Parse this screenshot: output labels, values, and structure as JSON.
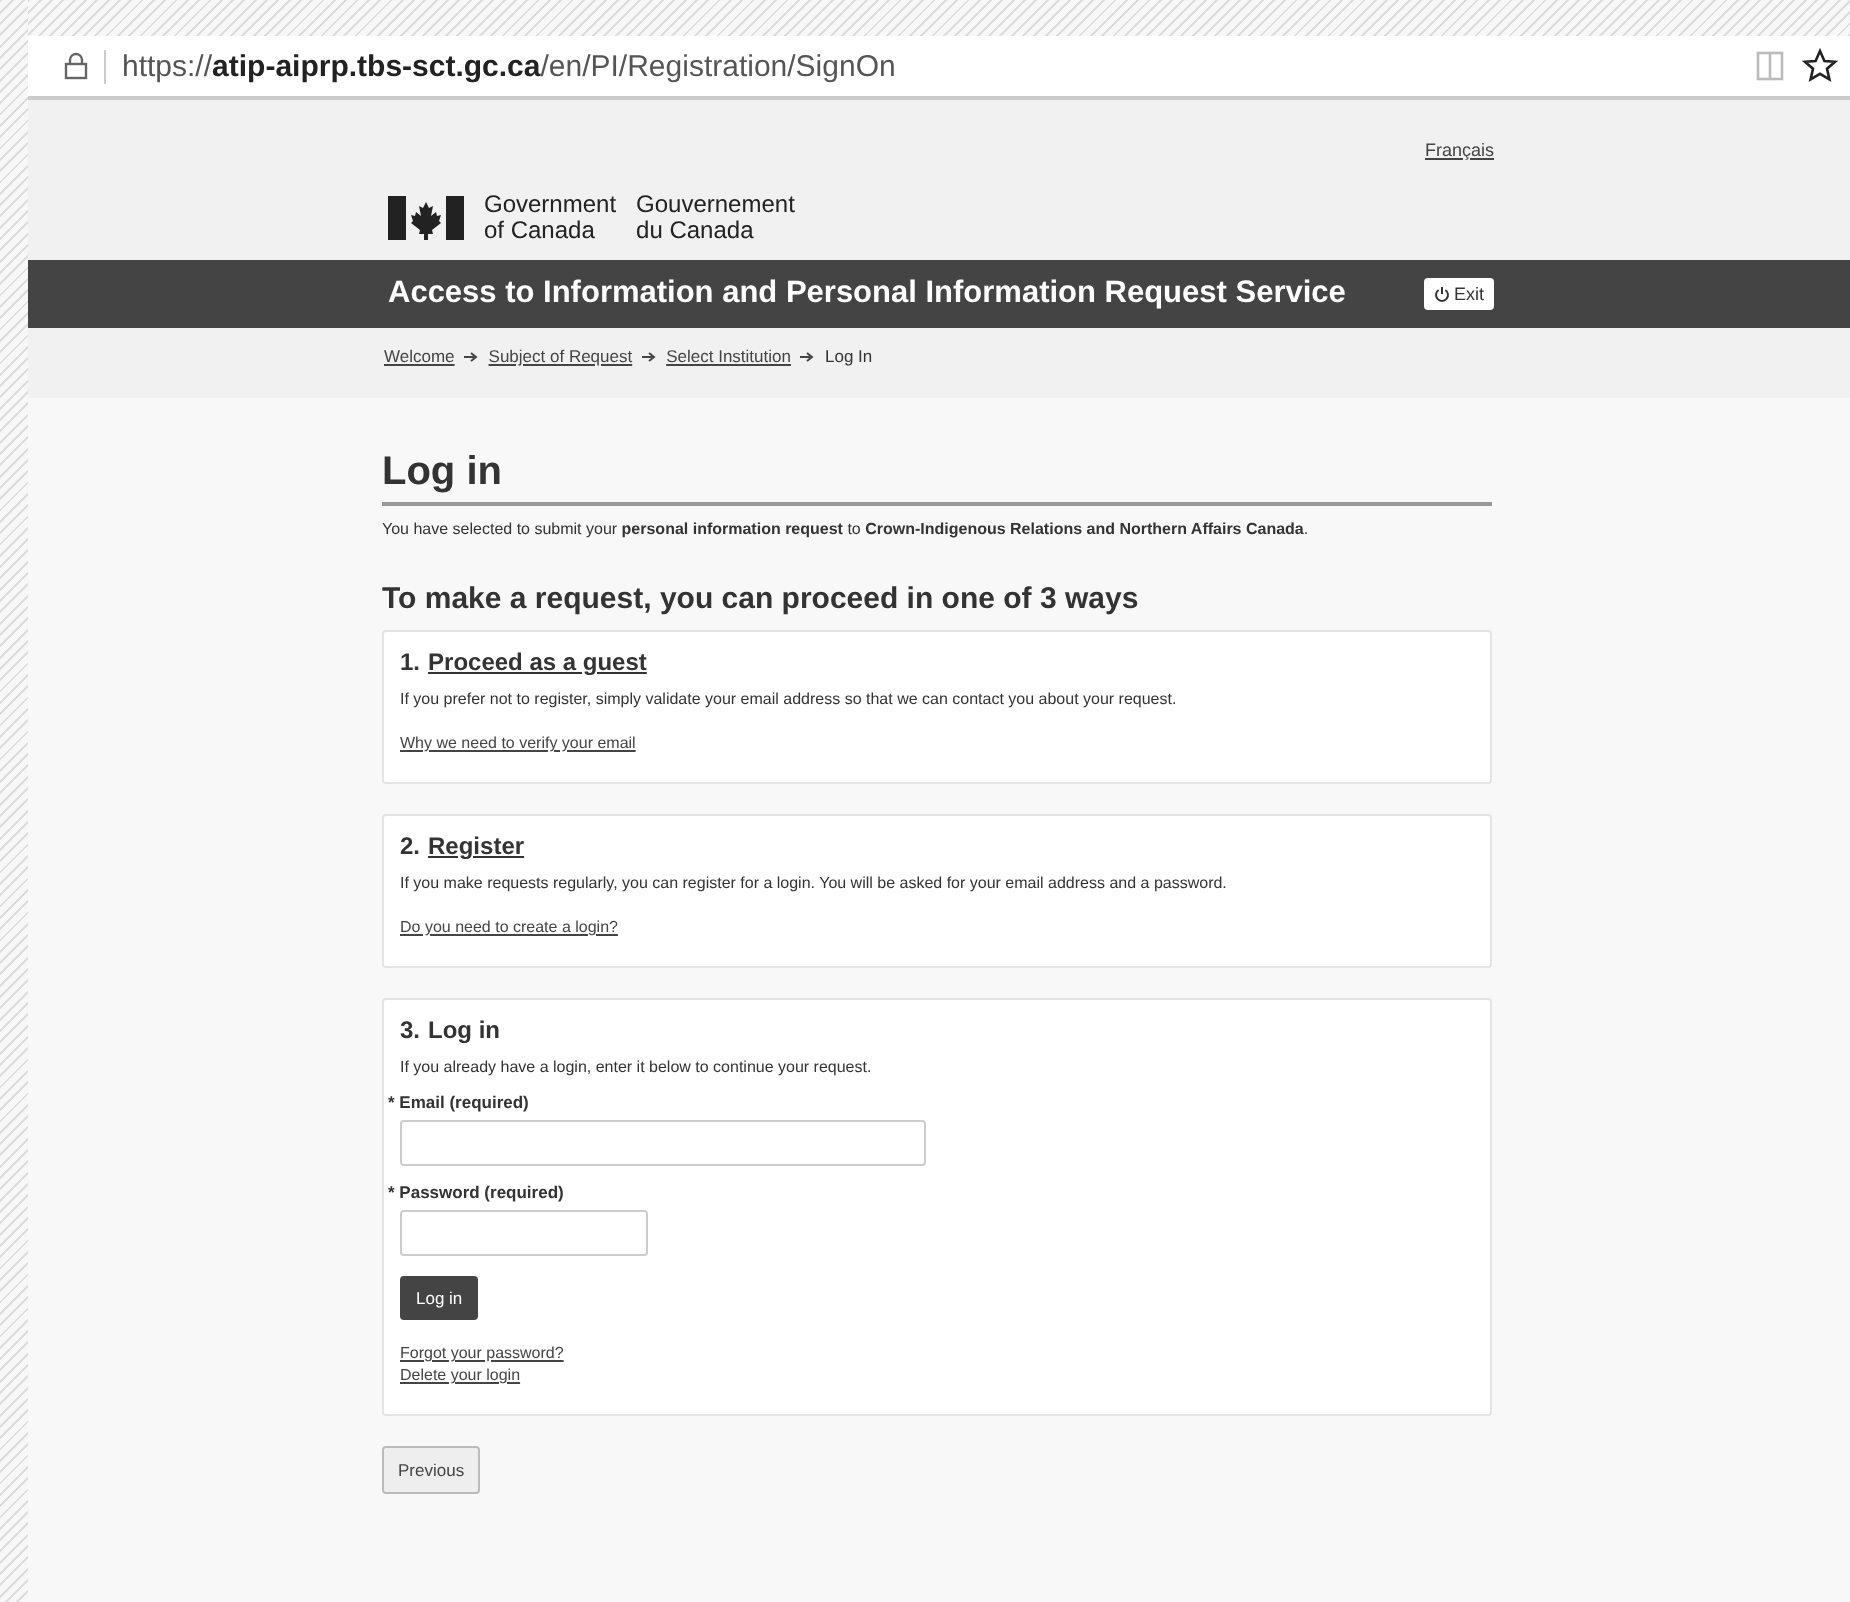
{
  "browser": {
    "url": "https://**atip-aiprp.tbs-sct.gc.ca**/en/PI/Registration/SignOn"
  },
  "language_link": "Français",
  "signature": {
    "english": [
      "Government",
      "of Canada"
    ],
    "french": [
      "Gouvernement",
      "du Canada"
    ]
  },
  "banner": {
    "title": "Access to Information and Personal Information Request Service",
    "exit_button": "Exit"
  },
  "breadcrumbs": [
    {
      "label": "Welcome",
      "kind": "link"
    },
    {
      "label": "Subject of Request",
      "kind": "link"
    },
    {
      "label": "Select Institution",
      "kind": "link"
    },
    {
      "label": "Log In",
      "kind": "current"
    }
  ],
  "page_title": "Log in",
  "intro": "You have selected to submit your **personal information request** to **Crown-Indigenous Relations and Northern Affairs Canada**.",
  "options_heading": "To make a request, you can proceed in one of 3 ways",
  "options": [
    {
      "number": "1.",
      "title": "Proceed as a guest",
      "kind": "link",
      "description": "If you prefer not to register, simply validate your email address so that we can contact you about your request.",
      "links": [
        "Why we need to verify your email"
      ]
    },
    {
      "number": "2.",
      "title": "Register",
      "kind": "link",
      "description": "If you make requests regularly, you can register for a login. You will be asked for your email address and a password.",
      "links": [
        "Do you need to create a login?"
      ]
    },
    {
      "number": "3.",
      "title": "Log in",
      "kind": "form",
      "description": "If you already have a login, enter it below to continue your request.",
      "fields": [
        {
          "label": "* Email (required)",
          "kind": "email"
        },
        {
          "label": "* Password (required)",
          "kind": "password"
        }
      ],
      "button": "Log in",
      "links": [
        "Forgot your password?",
        "Delete your login"
      ]
    }
  ],
  "previous_button": "Previous"
}
